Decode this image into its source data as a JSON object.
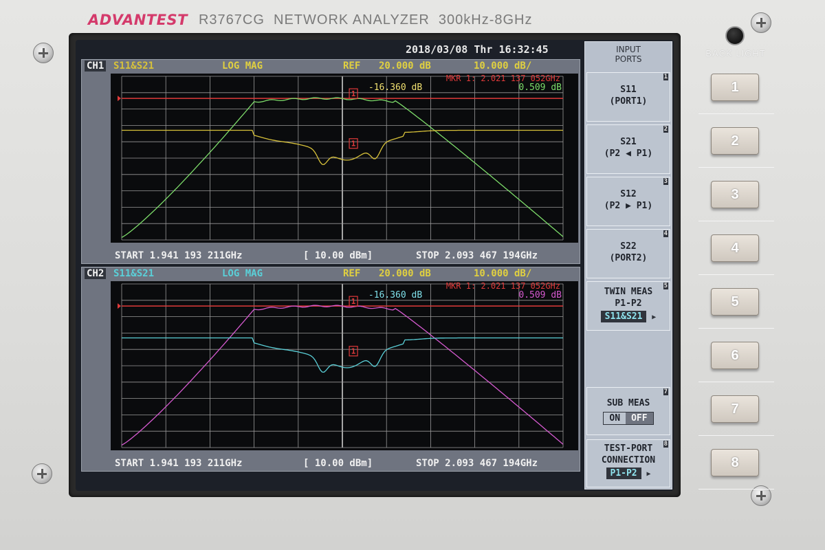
{
  "device": {
    "brand": "ADVANTEST",
    "model": "R3767CG  NETWORK ANALYZER  300kHz-8GHz",
    "backlight_label": "BACK LIGHT"
  },
  "screen": {
    "datetime": "2018/03/08 Thr 16:32:45"
  },
  "channels": [
    {
      "label": "CH1",
      "traces": "S11&S21",
      "format": "LOG MAG",
      "ref_label": "REF",
      "ref_value": "20.000 dB",
      "scale": "10.000 dB/",
      "marker_line": "MKR  1:  2.021 137 052GHz",
      "marker_val_a": "-16.360 dB",
      "marker_val_b": "0.509 dB",
      "marker_tag": "1",
      "start": "START 1.941 193 211GHz",
      "power": "[ 10.00 dBm]",
      "stop": "STOP 2.093 467 194GHz",
      "colors": {
        "s21": "#7ddc6a",
        "s11": "#d8c23a",
        "ref": "#e03a3a",
        "marker_a": "#f0e070",
        "marker_b": "#7ddc6a"
      }
    },
    {
      "label": "CH2",
      "traces": "S11&S21",
      "format": "LOG MAG",
      "ref_label": "REF",
      "ref_value": "20.000 dB",
      "scale": "10.000 dB/",
      "marker_line": "MKR  1:  2.021 137 052GHz",
      "marker_val_a": "-16.360 dB",
      "marker_val_b": "0.509 dB",
      "marker_tag": "1",
      "start": "START 1.941 193 211GHz",
      "power": "[ 10.00 dBm]",
      "stop": "STOP 2.093 467 194GHz",
      "colors": {
        "s21": "#d65ad0",
        "s11": "#5ad0d8",
        "ref": "#e03a3a",
        "marker_a": "#7fe0ea",
        "marker_b": "#d65ad0"
      }
    }
  ],
  "softkeys": {
    "header": "INPUT\nPORTS",
    "s11": {
      "line1": "S11",
      "line2": "(PORT1)",
      "num": "1"
    },
    "s21": {
      "line1": "S21",
      "line2": "(P2 ◀ P1)",
      "num": "2"
    },
    "s12": {
      "line1": "S12",
      "line2": "(P2 ▶ P1)",
      "num": "3"
    },
    "s22": {
      "line1": "S22",
      "line2": "(PORT2)",
      "num": "4"
    },
    "twin": {
      "line1": "TWIN MEAS",
      "line2": "P1-P2",
      "value": "S11&S21",
      "num": "5"
    },
    "sub": {
      "line1": "SUB MEAS",
      "on": "ON",
      "off": "OFF",
      "num": "7"
    },
    "testport": {
      "line1": "TEST-PORT",
      "line2": "CONNECTION",
      "value": "P1-P2",
      "num": "8"
    }
  },
  "hardware_buttons": [
    "1",
    "2",
    "3",
    "4",
    "5",
    "6",
    "7",
    "8"
  ]
}
